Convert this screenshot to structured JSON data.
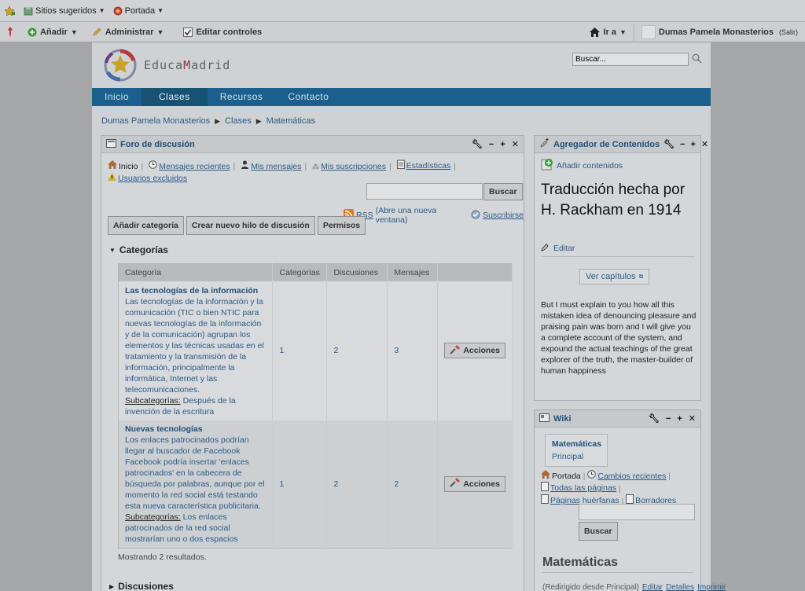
{
  "browser": {
    "bookmarks": [
      {
        "label": "Sitios sugeridos",
        "icon": "favorites-icon"
      },
      {
        "label": "Portada",
        "icon": "web-slice-icon"
      }
    ]
  },
  "dockbar": {
    "add": "Añadir",
    "manage": "Administrar",
    "edit_controls": "Editar controles",
    "goto": "Ir a",
    "user_name": "Dumas Pamela Monasterios",
    "sign_out": "(Salir)"
  },
  "header": {
    "logo_parts": [
      "E",
      "duca",
      "M",
      "adrid"
    ],
    "search_value": "Buscar..."
  },
  "nav": [
    "Inicio",
    "Clases",
    "Recursos",
    "Contacto"
  ],
  "breadcrumb": [
    "Dumas Pamela Monasterios",
    "Clases",
    "Matemáticas"
  ],
  "forum": {
    "title": "Foro de discusión",
    "links": {
      "home": "Inicio",
      "recent": "Mensajes recientes",
      "my_posts": "Mis mensajes",
      "subscriptions": "Mis suscripciones",
      "stats": "Estadísticas",
      "banned": "Usuarios excluidos"
    },
    "search_button": "Buscar",
    "rss": "RSS",
    "rss_note": "(Abre una nueva ventana)",
    "subscribe": "Suscribirse",
    "buttons": {
      "add_category": "Añadir categoría",
      "new_thread": "Crear nuevo hilo de discusión",
      "permissions": "Permisos"
    },
    "categories_heading": "Categorías",
    "columns": [
      "Categoría",
      "Categorías",
      "Discusiones",
      "Mensajes",
      ""
    ],
    "rows": [
      {
        "name": "Las tecnologías de la información",
        "description": "Las tecnologías de la información y la comunicación (TIC o bien NTIC para nuevas tecnologías de la información y de la comunicación) agrupan los elementos y las técnicas usadas en el tratamiento y la transmisión de la información, principalmente la informática, Internet y las telecomunicaciones.",
        "subcat_label": "Subcategorías:",
        "subcat": "Después de la invención de la escritura",
        "categories": "1",
        "threads": "2",
        "posts": "3",
        "action": "Acciones"
      },
      {
        "name": "Nuevas tecnologías",
        "description": "Los enlaces patrocinados podrían llegar al buscador de Facebook Facebook podría insertar 'enlaces patrocinados' en la cabecera de búsqueda por palabras, aunque por el momento la red social está testando esta nueva característica publicitaria.",
        "subcat_label": "Subcategorías:",
        "subcat": "Los enlaces patrocinados de la red social mostrarían uno o dos espacios",
        "categories": "1",
        "threads": "2",
        "posts": "2",
        "action": "Acciones"
      }
    ],
    "results": "Mostrando 2 resultados.",
    "discussions_heading": "Discusiones"
  },
  "aggregator": {
    "title": "Agregador de Contenidos",
    "add_content": "Añadir contenidos",
    "article_title": "Traducción hecha por H. Rackham en 1914",
    "edit": "Editar",
    "view_chapters": "Ver capítulos",
    "body": "But I must explain to you how all this mistaken idea of denouncing pleasure and praising pain was born and I will give you a complete account of the system, and expound the actual teachings of the great explorer of the truth, the master-builder of human happiness"
  },
  "wiki": {
    "title": "Wiki",
    "tabs": [
      "Matemáticas",
      "Principal"
    ],
    "links": {
      "frontpage": "Portada",
      "recent": "Cambios recientes",
      "all": "Todas las páginas",
      "orphan": "Páginas huérfanas",
      "drafts": "Borradores"
    },
    "search_button": "Buscar",
    "page_title": "Matemáticas",
    "footer": [
      "(Redirigido desde Principal)",
      "Editar",
      "Detalles",
      "Imprimir"
    ]
  }
}
